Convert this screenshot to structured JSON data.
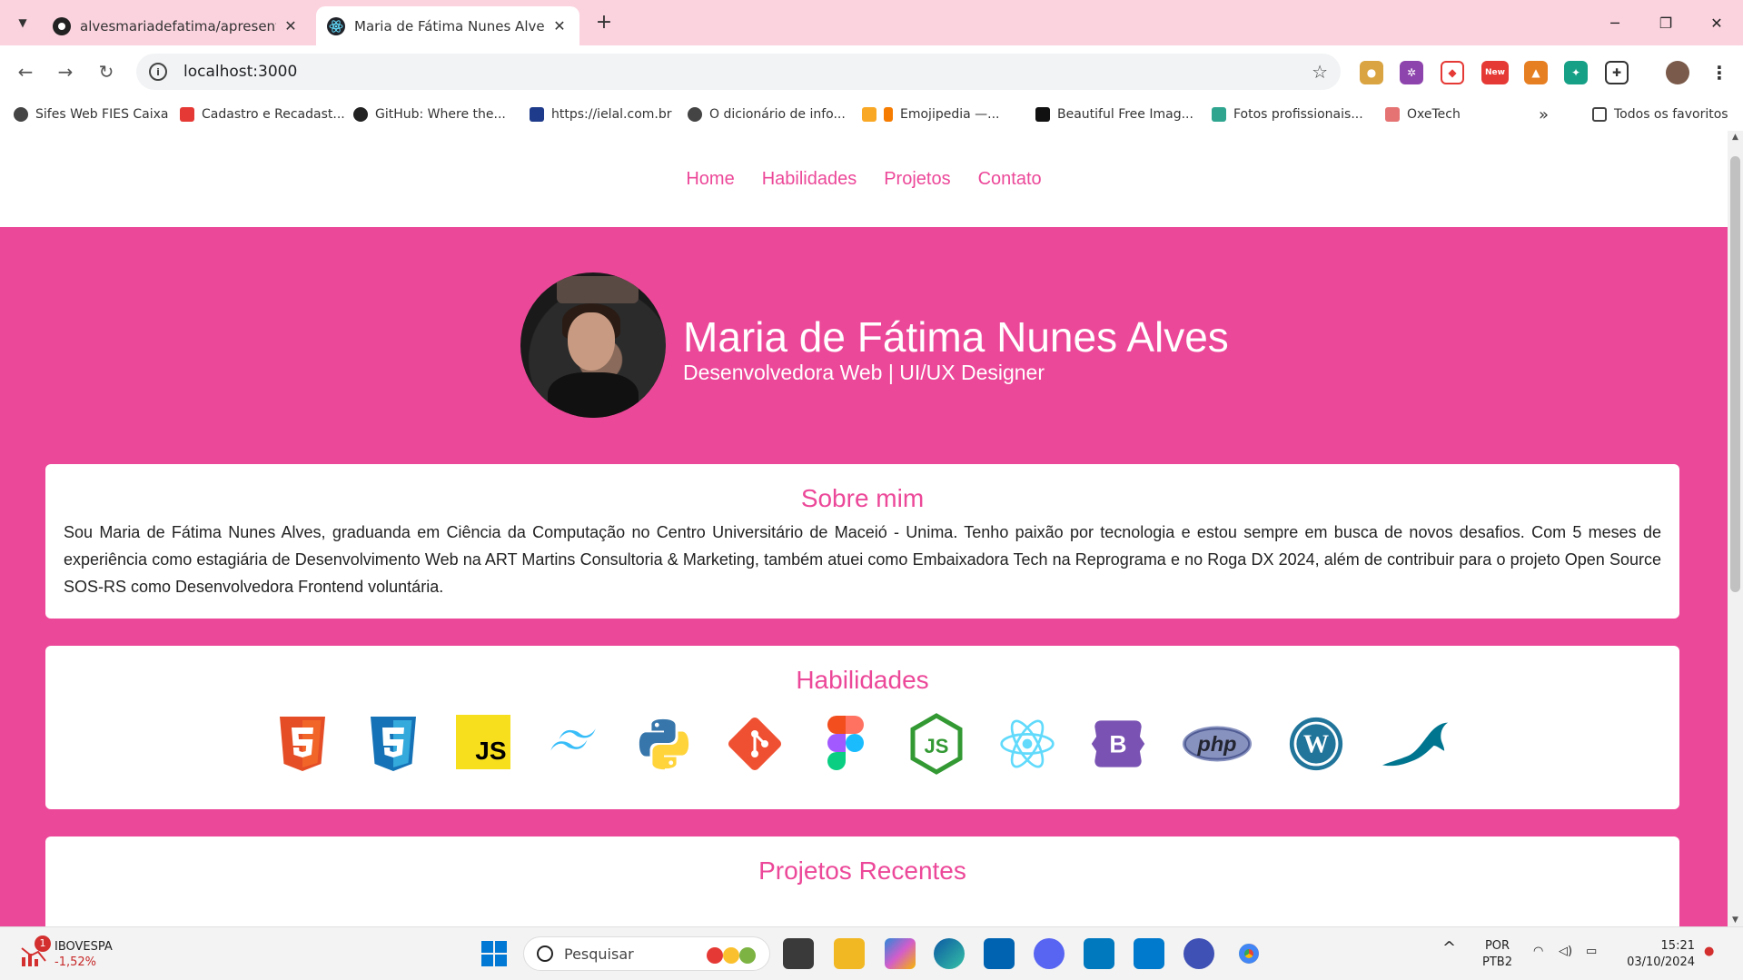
{
  "browser": {
    "tabs": [
      {
        "title": "alvesmariadefatima/apresentac",
        "active": false
      },
      {
        "title": "Maria de Fátima Nunes Alves | D",
        "active": true
      }
    ],
    "url": "localhost:3000",
    "extensions": [
      {
        "name": "cookie-extension-icon",
        "color": "#d9a441"
      },
      {
        "name": "puzzle-gear-extension-icon",
        "color": "#8e44ad"
      },
      {
        "name": "shield-extension-icon",
        "color": "#e53935"
      },
      {
        "name": "new-extension-icon",
        "color": "#e53935",
        "badge": "New"
      },
      {
        "name": "fox-extension-icon",
        "color": "#e67e22"
      },
      {
        "name": "bird-extension-icon",
        "color": "#16a085"
      }
    ],
    "bookmarks": [
      {
        "label": "Sifes Web FIES Caixa",
        "color": "#444444"
      },
      {
        "label": "Cadastro e Recadast...",
        "color": "#e53935"
      },
      {
        "label": "GitHub: Where the...",
        "color": "#222222"
      },
      {
        "label": "https://ielal.com.br",
        "color": "#1e3a8a"
      },
      {
        "label": "O dicionário de info...",
        "color": "#444444"
      },
      {
        "label": "Emojipedia —...",
        "color": "#f57c00"
      },
      {
        "label": "Beautiful Free Imag...",
        "color": "#111111"
      },
      {
        "label": "Fotos profissionais...",
        "color": "#2fa58f"
      },
      {
        "label": "OxeTech",
        "color": "#e57373"
      }
    ],
    "all_bookmarks": "Todos os favoritos",
    "more_bookmarks": "»"
  },
  "site": {
    "nav": [
      "Home",
      "Habilidades",
      "Projetos",
      "Contato"
    ],
    "name": "Maria de Fátima Nunes Alves",
    "role": "Desenvolvedora Web | UI/UX Designer",
    "about_title": "Sobre mim",
    "about_text": "Sou Maria de Fátima Nunes Alves, graduanda em Ciência da Computação no Centro Universitário de Maceió - Unima. Tenho paixão por tecnologia e estou sempre em busca de novos desafios. Com 5 meses de experiência como estagiária de Desenvolvimento Web na ART Martins Consultoria & Marketing, também atuei como Embaixadora Tech na Reprograma e no Roga DX 2024, além de contribuir para o projeto Open Source SOS-RS como Desenvolvedora Frontend voluntária.",
    "skills_title": "Habilidades",
    "skills": [
      {
        "icon": "html5-icon"
      },
      {
        "icon": "css3-icon"
      },
      {
        "icon": "javascript-icon",
        "text": "JS"
      },
      {
        "icon": "tailwind-icon"
      },
      {
        "icon": "python-icon"
      },
      {
        "icon": "git-icon"
      },
      {
        "icon": "figma-icon"
      },
      {
        "icon": "nodejs-icon",
        "text": "JS"
      },
      {
        "icon": "react-icon"
      },
      {
        "icon": "bootstrap-icon",
        "text": "B"
      },
      {
        "icon": "php-icon",
        "text": "php"
      },
      {
        "icon": "wordpress-icon",
        "text": "W"
      },
      {
        "icon": "mysql-icon"
      }
    ],
    "projects_title": "Projetos Recentes",
    "accent_color": "#ec4899"
  },
  "taskbar": {
    "stock_name": "IBOVESPA",
    "stock_change": "-1,52%",
    "stock_badge": "1",
    "search_placeholder": "Pesquisar",
    "lang_top": "POR",
    "lang_bottom": "PTB2",
    "time": "15:21",
    "date": "03/10/2024"
  }
}
